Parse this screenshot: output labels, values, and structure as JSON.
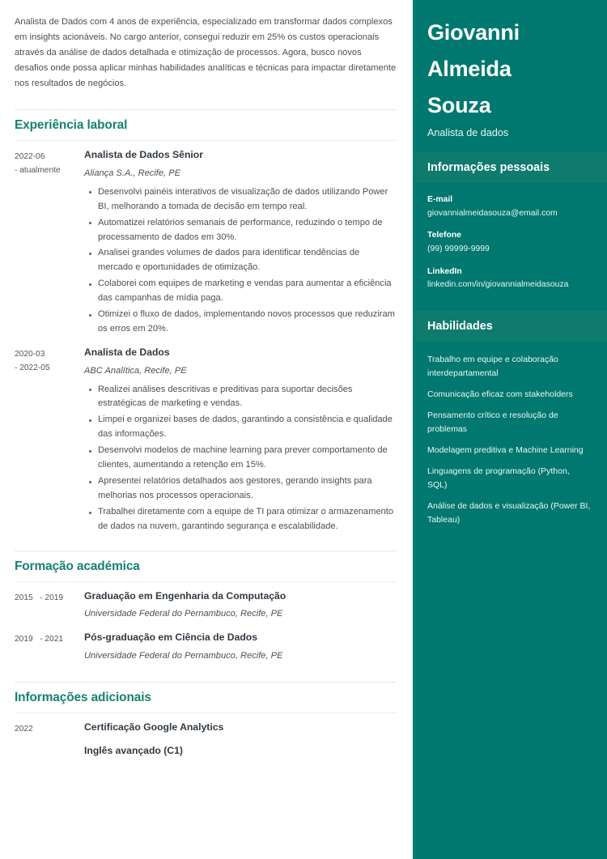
{
  "summary": "Analista de Dados com 4 anos de experiência, especializado em transformar dados complexos em insights acionáveis. No cargo anterior, consegui reduzir em 25% os custos operacionais através da análise de dados detalhada e otimização de processos. Agora, busco novos desafios onde possa aplicar minhas habilidades analíticas e técnicas para impactar diretamente nos resultados de negócios.",
  "sections": {
    "experience": {
      "title": "Experiência laboral",
      "entries": [
        {
          "date_start": "2022-06",
          "date_end": "- atualmente",
          "role": "Analista de Dados Sênior",
          "org": "Aliança S.A., Recife, PE",
          "bullets": [
            "Desenvolvi painéis interativos de visualização de dados utilizando Power BI, melhorando a tomada de decisão em tempo real.",
            "Automatizei relatórios semanais de performance, reduzindo o tempo de processamento de dados em 30%.",
            "Analisei grandes volumes de dados para identificar tendências de mercado e oportunidades de otimização.",
            "Colaborei com equipes de marketing e vendas para aumentar a eficiência das campanhas de mídia paga.",
            "Otimizei o fluxo de dados, implementando novos processos que reduziram os erros em 20%."
          ]
        },
        {
          "date_start": "2020-03",
          "date_end": "- 2022-05",
          "role": "Analista de Dados",
          "org": "ABC Analítica, Recife, PE",
          "bullets": [
            "Realizei análises descritivas e preditivas para suportar decisões estratégicas de marketing e vendas.",
            "Limpei e organizei bases de dados, garantindo a consistência e qualidade das informações.",
            "Desenvolvi modelos de machine learning para prever comportamento de clientes, aumentando a retenção em 15%.",
            "Apresentei relatórios detalhados aos gestores, gerando insights para melhorias nos processos operacionais.",
            "Trabalhei diretamente com a equipe de TI para otimizar o armazenamento de dados na nuvem, garantindo segurança e escalabilidade."
          ]
        }
      ]
    },
    "education": {
      "title": "Formação académica",
      "entries": [
        {
          "date_start": "2015",
          "date_end": "- 2019",
          "degree": "Graduação em Engenharia da Computação",
          "school": "Universidade Federal do Pernambuco, Recife, PE"
        },
        {
          "date_start": "2019",
          "date_end": "- 2021",
          "degree": "Pós-graduação em Ciência de Dados",
          "school": "Universidade Federal do Pernambuco, Recife, PE"
        }
      ]
    },
    "additional": {
      "title": "Informações adicionais",
      "date": "2022",
      "items": [
        "Certificação Google Analytics",
        "Inglês avançado (C1)"
      ]
    }
  },
  "sidebar": {
    "name_lines": [
      "Giovanni",
      "Almeida",
      "Souza"
    ],
    "job_title": "Analista de dados",
    "personal_info": {
      "title": "Informações pessoais",
      "items": [
        {
          "label": "E-mail",
          "value": "giovannialmeidasouza@email.com"
        },
        {
          "label": "Telefone",
          "value": "(99) 99999-9999"
        },
        {
          "label": "LinkedIn",
          "value": "linkedin.com/in/giovannialmeidasouza"
        }
      ]
    },
    "skills": {
      "title": "Habilidades",
      "items": [
        "Trabalho em equipe e colaboração interdepartamental",
        "Comunicação eficaz com stakeholders",
        "Pensamento crítico e resolução de problemas",
        "Modelagem preditiva e Machine Learning",
        "Linguagens de programação (Python, SQL)",
        "Análise de dados e visualização (Power BI, Tableau)"
      ]
    }
  },
  "colors": {
    "sidebar_bg": "#00786f",
    "sidebar_band": "#0f7a6e",
    "section_title": "#16816f",
    "body_text": "#4a4f55"
  }
}
